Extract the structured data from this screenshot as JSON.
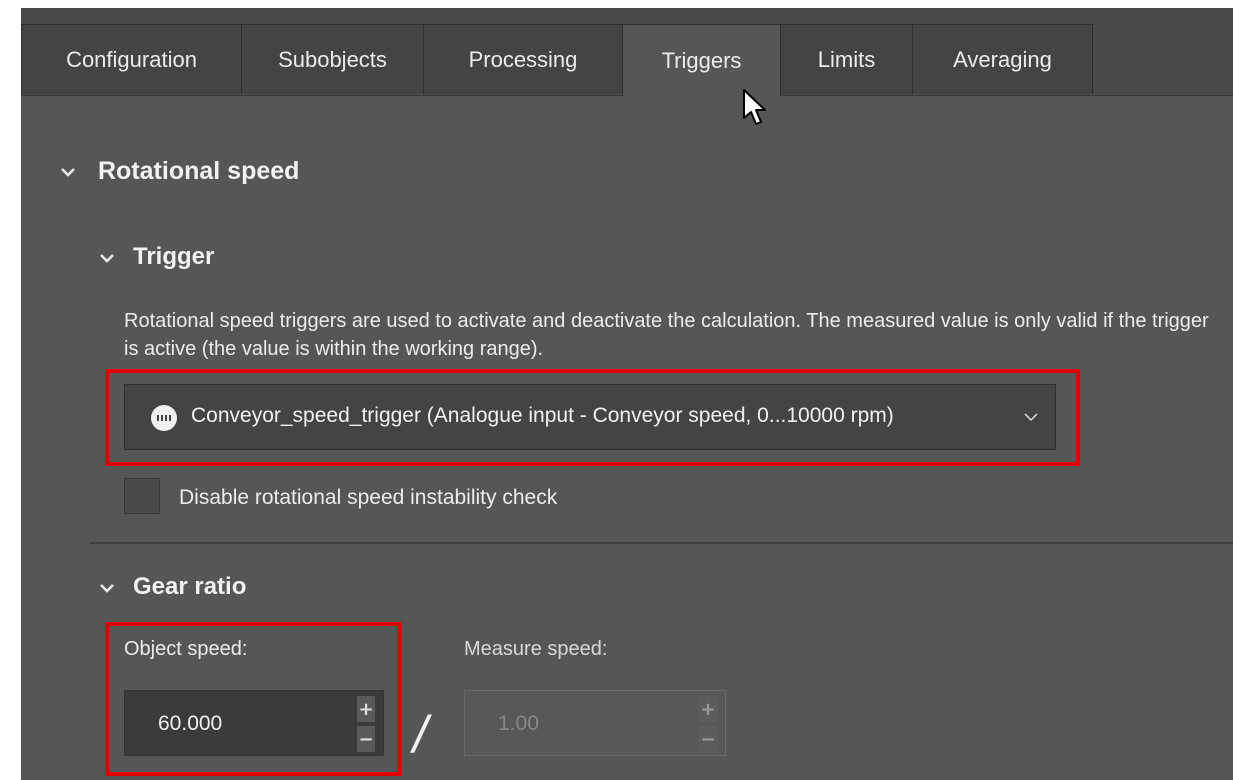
{
  "tabs": [
    {
      "label": "Configuration",
      "active": false
    },
    {
      "label": "Subobjects",
      "active": false
    },
    {
      "label": "Processing",
      "active": false
    },
    {
      "label": "Triggers",
      "active": true
    },
    {
      "label": "Limits",
      "active": false
    },
    {
      "label": "Averaging",
      "active": false
    }
  ],
  "sections": {
    "rotational_speed": {
      "title": "Rotational speed",
      "expanded": true
    },
    "trigger": {
      "title": "Trigger",
      "expanded": true,
      "description": "Rotational speed triggers are used to activate and deactivate the calculation. The measured value is only valid if the trigger is active (the value is within the working range).",
      "selected_trigger": "Conveyor_speed_trigger (Analogue input - Conveyor speed, 0...10000 rpm)",
      "trigger_icon": "analogue-input-icon",
      "disable_instability_check": {
        "label": "Disable rotational speed instability check",
        "checked": false
      }
    },
    "gear_ratio": {
      "title": "Gear ratio",
      "expanded": true,
      "object_speed": {
        "label": "Object speed:",
        "value": "60.000"
      },
      "separator": "/",
      "measure_speed": {
        "label": "Measure speed:",
        "value": "1.00",
        "disabled": true
      }
    }
  },
  "highlight_color": "#e00000"
}
